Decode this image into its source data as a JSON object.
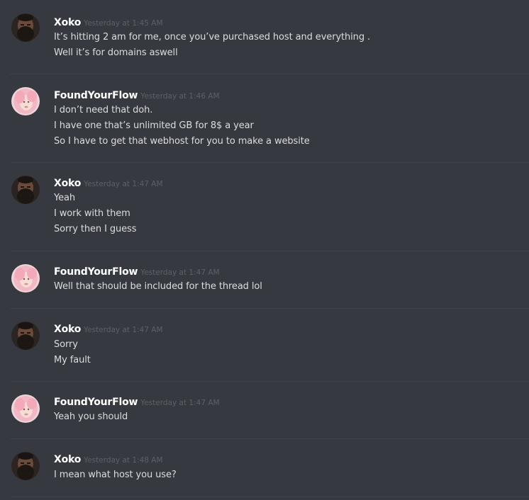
{
  "messages": [
    {
      "author": "Xoko",
      "avatar_icon": "avatar-bearded-man-icon",
      "timestamp": "Yesterday at 1:45 AM",
      "lines": [
        "It’s hitting 2 am for me, once you’ve purchased host and everything .",
        "Well it’s for domains aswell"
      ]
    },
    {
      "author": "FoundYourFlow",
      "avatar_icon": "avatar-pink-hair-icon",
      "timestamp": "Yesterday at 1:46 AM",
      "lines": [
        "I don’t need that doh.",
        "I have one that’s unlimited GB for 8$ a year",
        "So I have to get that webhost for you to make a website"
      ]
    },
    {
      "author": "Xoko",
      "avatar_icon": "avatar-bearded-man-icon",
      "timestamp": "Yesterday at 1:47 AM",
      "lines": [
        "Yeah",
        "I work with them",
        "Sorry then I guess"
      ]
    },
    {
      "author": "FoundYourFlow",
      "avatar_icon": "avatar-pink-hair-icon",
      "timestamp": "Yesterday at 1:47 AM",
      "lines": [
        "Well that should be included for the thread lol"
      ]
    },
    {
      "author": "Xoko",
      "avatar_icon": "avatar-bearded-man-icon",
      "timestamp": "Yesterday at 1:47 AM",
      "lines": [
        "Sorry",
        "My fault"
      ]
    },
    {
      "author": "FoundYourFlow",
      "avatar_icon": "avatar-pink-hair-icon",
      "timestamp": "Yesterday at 1:47 AM",
      "lines": [
        "Yeah you should"
      ]
    },
    {
      "author": "Xoko",
      "avatar_icon": "avatar-bearded-man-icon",
      "timestamp": "Yesterday at 1:48 AM",
      "lines": [
        "I mean what host you use?"
      ]
    }
  ],
  "colors": {
    "background": "#36393f",
    "divider": "#3f4248",
    "username": "#ffffff",
    "timestamp": "#5d6066",
    "message_text": "#dcddde"
  }
}
